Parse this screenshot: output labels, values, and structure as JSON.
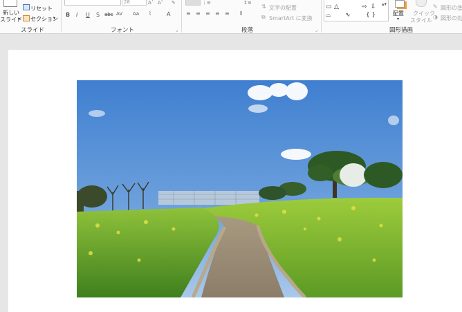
{
  "ribbon": {
    "slides": {
      "new_slide_label": "新しい",
      "new_slide_label2": "スライド",
      "reset_label": "リセット",
      "section_label": "セクション",
      "group_label": "スライド"
    },
    "font": {
      "size_value": "28",
      "group_label": "フォント",
      "bold": "B",
      "italic": "I",
      "underline": "U",
      "shadow": "S",
      "strike": "abc",
      "spacing": "AV",
      "case": "Aa",
      "font_color": "A"
    },
    "paragraph": {
      "text_direction_label": "文字の配置",
      "smartart_label": "SmartArt に変換",
      "group_label": "段落"
    },
    "drawing": {
      "arrange_label": "配置",
      "quick_style_label": "クイック",
      "quick_style_label2": "スタイル",
      "shape_fill_label": "図形の塗",
      "shape_effects_label": "図形の効",
      "group_label": "図形描画"
    }
  },
  "colors": {
    "ribbon_bg": "#fbfbfb",
    "workspace_bg": "#e6e6e6",
    "slide_bg": "#ffffff",
    "sky": "#5b8fd1",
    "grass": "#5a9a2a"
  }
}
